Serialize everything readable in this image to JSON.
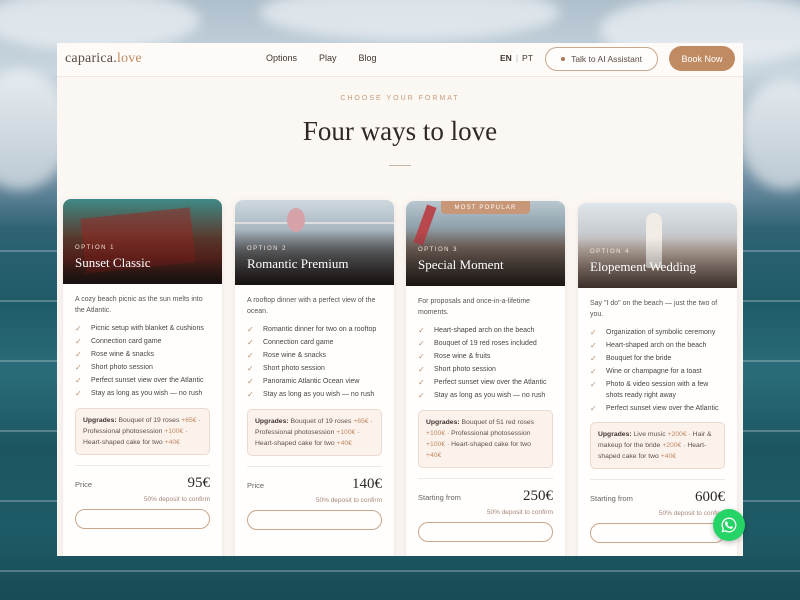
{
  "nav": {
    "logo_main": "caparica",
    "logo_dot": ".",
    "logo_accent": "love",
    "links": [
      "Options",
      "Play",
      "Blog"
    ],
    "lang_active": "EN",
    "lang_other": "PT",
    "ai_button": "Talk to AI Assistant",
    "book_button": "Book Now"
  },
  "hero": {
    "eyebrow": "CHOOSE YOUR FORMAT",
    "title": "Four ways to love"
  },
  "cards": [
    {
      "option": "OPTION 1",
      "title": "Sunset Classic",
      "desc": "A cozy beach picnic as the sun melts into the Atlantic.",
      "features": [
        "Picnic setup with blanket & cushions",
        "Connection card game",
        "Rose wine & snacks",
        "Short photo session",
        "Perfect sunset view over the Atlantic",
        "Stay as long as you wish — no rush"
      ],
      "upgrades_label": "Upgrades:",
      "upgrades": [
        {
          "name": " Bouquet of 19 roses ",
          "price": "+65€"
        },
        {
          "name": " · Professional photosession ",
          "price": "+100€"
        },
        {
          "name": " · Heart-shaped cake for two ",
          "price": "+40€"
        }
      ],
      "price_label": "Price",
      "price": "95€",
      "deposit": "50% deposit to confirm"
    },
    {
      "option": "OPTION 2",
      "title": "Romantic Premium",
      "desc": "A rooftop dinner with a perfect view of the ocean.",
      "features": [
        "Romantic dinner for two on a rooftop",
        "Connection card game",
        "Rose wine & snacks",
        "Short photo session",
        "Panoramic Atlantic Ocean view",
        "Stay as long as you wish — no rush"
      ],
      "upgrades_label": "Upgrades:",
      "upgrades": [
        {
          "name": " Bouquet of 19 roses ",
          "price": "+65€"
        },
        {
          "name": " · Professional photosession ",
          "price": "+100€"
        },
        {
          "name": " · Heart-shaped cake for two ",
          "price": "+40€"
        }
      ],
      "price_label": "Price",
      "price": "140€",
      "deposit": "50% deposit to confirm"
    },
    {
      "badge": "MOST POPULAR",
      "option": "OPTION 3",
      "title": "Special Moment",
      "desc": "For proposals and once-in-a-lifetime moments.",
      "features": [
        "Heart-shaped arch on the beach",
        "Bouquet of 19 red roses included",
        "Rose wine & fruits",
        "Short photo session",
        "Perfect sunset view over the Atlantic",
        "Stay as long as you wish — no rush"
      ],
      "upgrades_label": "Upgrades:",
      "upgrades": [
        {
          "name": " Bouquet of 51 red roses ",
          "price": "+100€"
        },
        {
          "name": " · Professional photosession ",
          "price": "+100€"
        },
        {
          "name": " · Heart-shaped cake for two ",
          "price": "+40€"
        }
      ],
      "price_label": "Starting from",
      "price": "250€",
      "deposit": "50% deposit to confirm"
    },
    {
      "option": "OPTION 4",
      "title": "Elopement Wedding",
      "desc": "Say \"I do\" on the beach — just the two of you.",
      "features": [
        "Organization of symbolic ceremony",
        "Heart-shaped arch on the beach",
        "Bouquet for the bride",
        "Wine or champagne for a toast",
        "Photo & video session with a few shots ready right away",
        "Perfect sunset view over the Atlantic"
      ],
      "upgrades_label": "Upgrades:",
      "upgrades": [
        {
          "name": " Live music ",
          "price": "+200€"
        },
        {
          "name": " · Hair & makeup for the bride ",
          "price": "+200€"
        },
        {
          "name": " · Heart-shaped cake for two ",
          "price": "+40€"
        }
      ],
      "price_label": "Starting from",
      "price": "600€",
      "deposit": "50% deposit to confirm"
    }
  ],
  "colors": {
    "accent": "#c08b63",
    "background": "#fbf7f3",
    "whatsapp": "#25d366"
  }
}
